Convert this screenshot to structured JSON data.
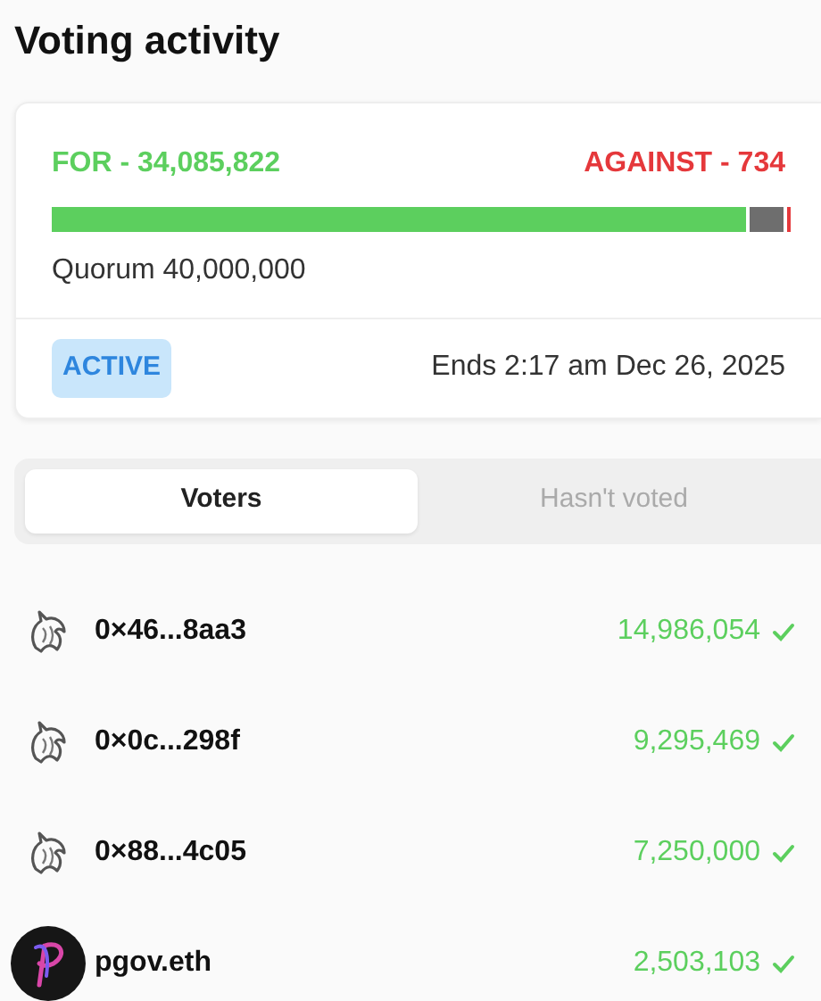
{
  "title": "Voting activity",
  "summary": {
    "for_label": "FOR - 34,085,822",
    "against_label": "AGAINST - 734",
    "bar": [
      {
        "level": 0.94,
        "color": "#5ccf5e"
      },
      {
        "level": 0.045,
        "color": "#6e6e6e"
      },
      {
        "level": 0.005,
        "color": "#e5383b"
      }
    ],
    "quorum": "Quorum 40,000,000",
    "status": "ACTIVE",
    "ends": "Ends 2:17 am Dec 26, 2025"
  },
  "tabs": [
    {
      "label": "Voters",
      "selected": true
    },
    {
      "label": "Hasn't voted",
      "selected": false
    }
  ],
  "voters": [
    {
      "name": "0×46...8aa3",
      "kind": "unicorn",
      "votes": "14,986,054"
    },
    {
      "name": "0×0c...298f",
      "kind": "unicorn",
      "votes": "9,295,469"
    },
    {
      "name": "0×88...4c05",
      "kind": "unicorn",
      "votes": "7,250,000"
    },
    {
      "name": "pgov.eth",
      "kind": "logo",
      "votes": "2,503,103"
    }
  ]
}
